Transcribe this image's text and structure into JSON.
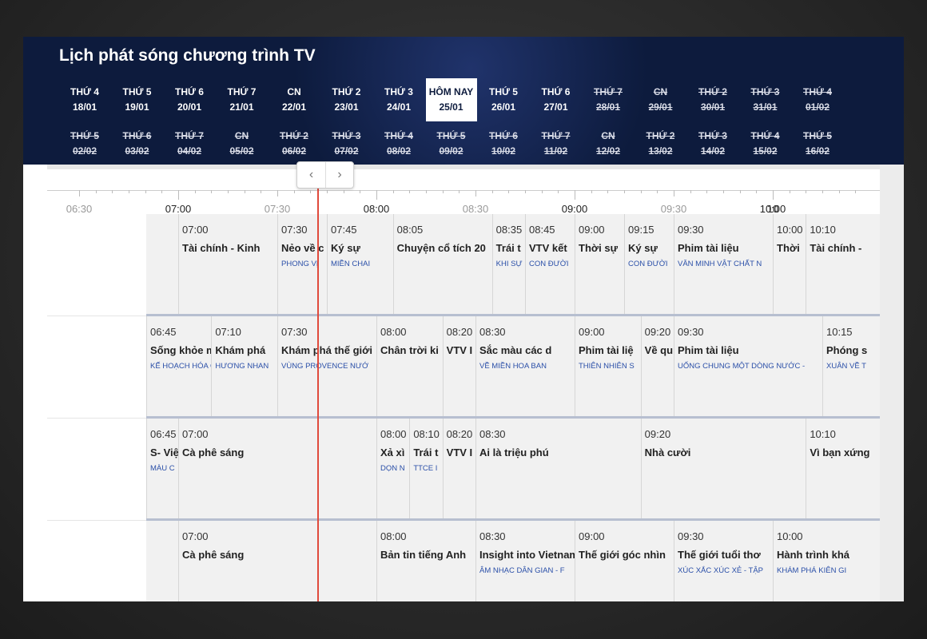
{
  "title": "Lịch phát sóng chương trình   TV",
  "dates": [
    {
      "day": "THỨ 4",
      "date": "18/01",
      "state": "normal"
    },
    {
      "day": "THỨ 5",
      "date": "19/01",
      "state": "normal"
    },
    {
      "day": "THỨ 6",
      "date": "20/01",
      "state": "normal"
    },
    {
      "day": "THỨ 7",
      "date": "21/01",
      "state": "normal"
    },
    {
      "day": "CN",
      "date": "22/01",
      "state": "normal"
    },
    {
      "day": "THỨ 2",
      "date": "23/01",
      "state": "normal"
    },
    {
      "day": "THỨ 3",
      "date": "24/01",
      "state": "normal"
    },
    {
      "day": "HÔM NAY",
      "date": "25/01",
      "state": "today"
    },
    {
      "day": "THỨ 5",
      "date": "26/01",
      "state": "normal"
    },
    {
      "day": "THỨ 6",
      "date": "27/01",
      "state": "normal"
    },
    {
      "day": "THỨ 7",
      "date": "28/01",
      "state": "past"
    },
    {
      "day": "CN",
      "date": "29/01",
      "state": "past"
    },
    {
      "day": "THỨ 2",
      "date": "30/01",
      "state": "past"
    },
    {
      "day": "THỨ 3",
      "date": "31/01",
      "state": "past"
    },
    {
      "day": "THỨ 4",
      "date": "01/02",
      "state": "past"
    },
    {
      "day": "THỨ 5",
      "date": "02/02",
      "state": "past"
    },
    {
      "day": "THỨ 6",
      "date": "03/02",
      "state": "past"
    },
    {
      "day": "THỨ 7",
      "date": "04/02",
      "state": "past"
    },
    {
      "day": "CN",
      "date": "05/02",
      "state": "past"
    },
    {
      "day": "THỨ 2",
      "date": "06/02",
      "state": "past"
    },
    {
      "day": "THỨ 3",
      "date": "07/02",
      "state": "past"
    },
    {
      "day": "THỨ 4",
      "date": "08/02",
      "state": "past"
    },
    {
      "day": "THỨ 5",
      "date": "09/02",
      "state": "past"
    },
    {
      "day": "THỨ 6",
      "date": "10/02",
      "state": "past"
    },
    {
      "day": "THỨ 7",
      "date": "11/02",
      "state": "past"
    },
    {
      "day": "CN",
      "date": "12/02",
      "state": "past"
    },
    {
      "day": "THỨ 2",
      "date": "13/02",
      "state": "past"
    },
    {
      "day": "THỨ 3",
      "date": "14/02",
      "state": "past"
    },
    {
      "day": "THỨ 4",
      "date": "15/02",
      "state": "past"
    },
    {
      "day": "THỨ 5",
      "date": "16/02",
      "state": "past"
    }
  ],
  "nav": {
    "prev": "‹",
    "next": "›"
  },
  "timeline": {
    "start": "06:30",
    "ticks": [
      "06:30",
      "07:00",
      "07:30",
      "08:00",
      "08:30",
      "09:00",
      "09:30",
      "10:00",
      "10"
    ],
    "now": "07:42"
  },
  "channels": [
    {
      "programs": [
        {
          "time": "07:00",
          "start": "07:00",
          "name": "Tài chính - Kinh",
          "sub": ""
        },
        {
          "time": "07:30",
          "start": "07:30",
          "name": "Nẻo về c",
          "sub": "PHONG VỊ"
        },
        {
          "time": "07:45",
          "start": "07:45",
          "name": "Ký sự",
          "sub": "MIỀN CHAI"
        },
        {
          "time": "08:05",
          "start": "08:05",
          "name": "Chuyện cổ tích 20",
          "sub": ""
        },
        {
          "time": "08:35",
          "start": "08:35",
          "name": "Trái t",
          "sub": "KHI SỰ"
        },
        {
          "time": "08:45",
          "start": "08:45",
          "name": "VTV kết",
          "sub": "CON ĐƯỜI"
        },
        {
          "time": "09:00",
          "start": "09:00",
          "name": "Thời sự",
          "sub": ""
        },
        {
          "time": "09:15",
          "start": "09:15",
          "name": "Ký sự",
          "sub": "CON ĐƯỜI"
        },
        {
          "time": "09:30",
          "start": "09:30",
          "name": "Phim tài liệu",
          "sub": "VĂN MINH VẬT CHẤT N"
        },
        {
          "time": "10:00",
          "start": "10:00",
          "name": "Thời",
          "sub": ""
        },
        {
          "time": "10:10",
          "start": "10:10",
          "name": "Tài chính -",
          "sub": ""
        }
      ]
    },
    {
      "programs": [
        {
          "time": "06:45",
          "start": "06:45",
          "name": "Sống khỏe mỗi",
          "sub": "KẾ HOẠCH HÓA GI"
        },
        {
          "time": "07:10",
          "start": "07:10",
          "name": "Khám phá",
          "sub": "HƯƠNG NHAN"
        },
        {
          "time": "07:30",
          "start": "07:30",
          "name": "Khám phá thế giới",
          "sub": "VÙNG PROVENCE NƯỚ"
        },
        {
          "time": "08:00",
          "start": "08:00",
          "name": "Chân trời ki",
          "sub": ""
        },
        {
          "time": "08:20",
          "start": "08:20",
          "name": "VTV I",
          "sub": ""
        },
        {
          "time": "08:30",
          "start": "08:30",
          "name": "Sắc màu các d",
          "sub": "VỀ MIỀN HOA BAN"
        },
        {
          "time": "09:00",
          "start": "09:00",
          "name": "Phim tài liệ",
          "sub": "THIÊN NHIÊN S"
        },
        {
          "time": "09:20",
          "start": "09:20",
          "name": "Về qu",
          "sub": ""
        },
        {
          "time": "09:30",
          "start": "09:30",
          "name": "Phim tài liệu",
          "sub": "UỐNG CHUNG MỘT DÒNG NƯỚC -"
        },
        {
          "time": "10:15",
          "start": "10:15",
          "name": "Phóng s",
          "sub": "XUÂN VỀ T"
        }
      ]
    },
    {
      "programs": [
        {
          "time": "06:45",
          "start": "06:45",
          "name": "S- Việ",
          "sub": "MÀU C"
        },
        {
          "time": "07:00",
          "start": "07:00",
          "name": "Cà phê sáng",
          "sub": ""
        },
        {
          "time": "08:00",
          "start": "08:00",
          "name": "Xả xì",
          "sub": "DỌN N"
        },
        {
          "time": "08:10",
          "start": "08:10",
          "name": "Trái t",
          "sub": "TTCE I"
        },
        {
          "time": "08:20",
          "start": "08:20",
          "name": "VTV I",
          "sub": ""
        },
        {
          "time": "08:30",
          "start": "08:30",
          "name": "Ai là triệu phú",
          "sub": ""
        },
        {
          "time": "09:20",
          "start": "09:20",
          "name": "Nhà cười",
          "sub": ""
        },
        {
          "time": "10:10",
          "start": "10:10",
          "name": "Vì bạn xứng",
          "sub": ""
        }
      ]
    },
    {
      "programs": [
        {
          "time": "07:00",
          "start": "07:00",
          "name": "Cà phê sáng",
          "sub": ""
        },
        {
          "time": "08:00",
          "start": "08:00",
          "name": "Bản tin tiếng Anh",
          "sub": ""
        },
        {
          "time": "08:30",
          "start": "08:30",
          "name": "Insight into Vietnam",
          "sub": "ÂM NHẠC DÂN GIAN - F"
        },
        {
          "time": "09:00",
          "start": "09:00",
          "name": "Thế giới góc nhìn",
          "sub": ""
        },
        {
          "time": "09:30",
          "start": "09:30",
          "name": "Thế giới tuổi thơ",
          "sub": "XÚC XẮC XÚC XẺ - TẬP"
        },
        {
          "time": "10:00",
          "start": "10:00",
          "name": "Hành trình khá",
          "sub": "KHÁM PHÁ KIÊN GI"
        }
      ]
    }
  ]
}
